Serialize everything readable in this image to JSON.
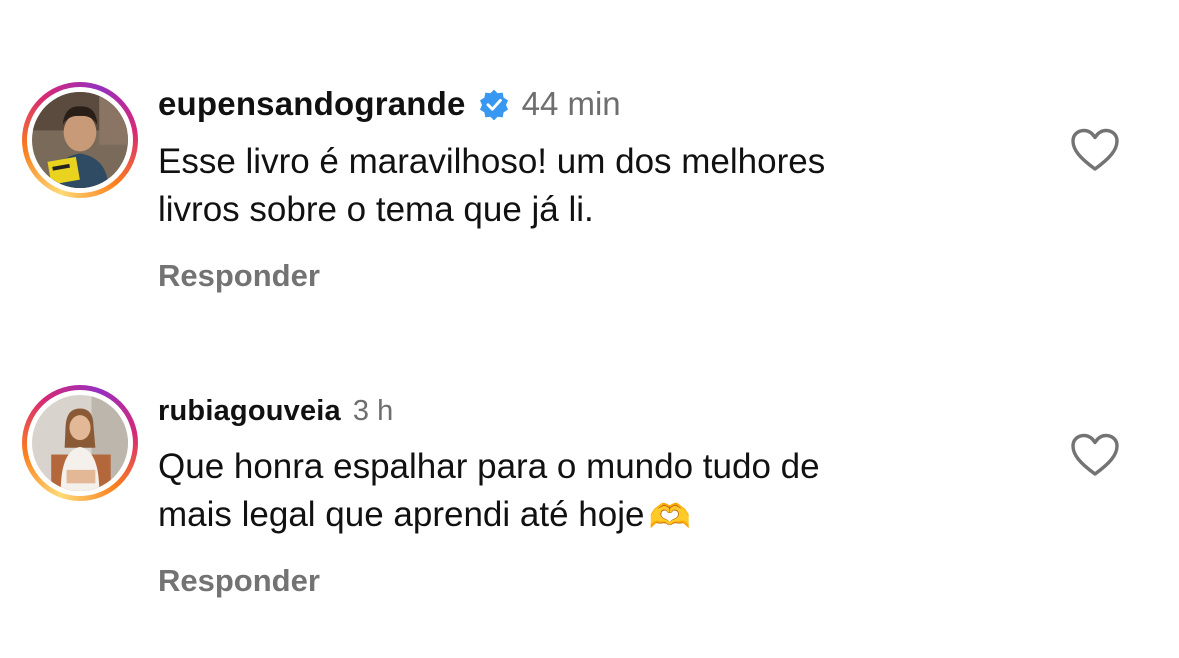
{
  "comments": [
    {
      "username": "eupensandogrande",
      "verified": true,
      "time": "44 min",
      "lines": [
        "Esse livro é maravilhoso! um dos melhores",
        "livros sobre o tema que já li."
      ],
      "reply_label": "Responder",
      "avatar_icon": "profile-photo-man-holding-yellow-book"
    },
    {
      "username": "rubiagouveia",
      "verified": false,
      "time": "3 h",
      "lines": [
        "Que honra espalhar para o mundo tudo de",
        "mais legal que aprendi até hoje"
      ],
      "emoji": "🫶",
      "reply_label": "Responder",
      "avatar_icon": "profile-photo-woman-seated"
    }
  ],
  "colors": {
    "verified_badge": "#3897f0",
    "secondary_text": "#737373",
    "story_ring": [
      "#feda75",
      "#fa7e1e",
      "#d62976",
      "#962fbf"
    ]
  }
}
